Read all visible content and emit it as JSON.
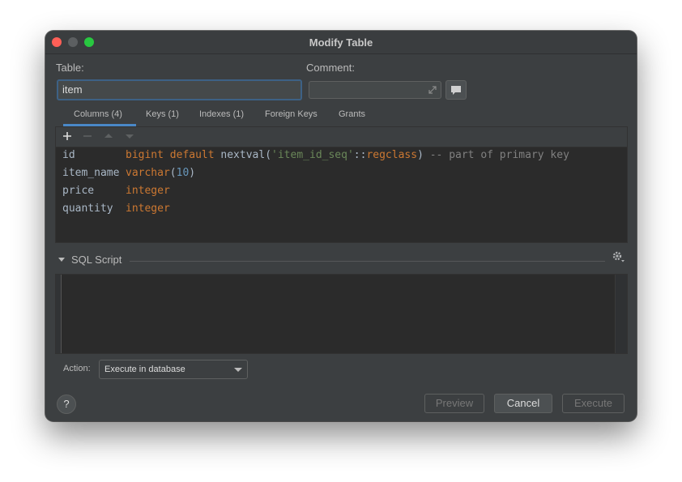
{
  "window": {
    "title": "Modify Table"
  },
  "form": {
    "table_label": "Table:",
    "table_value": "item",
    "comment_label": "Comment:",
    "comment_value": ""
  },
  "tabs": [
    {
      "label": "Columns (4)",
      "active": true
    },
    {
      "label": "Keys (1)",
      "active": false
    },
    {
      "label": "Indexes (1)",
      "active": false
    },
    {
      "label": "Foreign Keys",
      "active": false
    },
    {
      "label": "Grants",
      "active": false
    }
  ],
  "columns": [
    {
      "name": "id",
      "def": {
        "kw1": "bigint default",
        "fn": "nextval(",
        "str": "'item_id_seq'",
        "op": "::",
        "kw2": "regclass",
        "close": ")",
        "comment": "-- part of primary key"
      }
    },
    {
      "name": "item_name",
      "def": {
        "type": "varchar",
        "open": "(",
        "num": "10",
        "close": ")"
      }
    },
    {
      "name": "price",
      "def": {
        "type": "integer"
      }
    },
    {
      "name": "quantity",
      "def": {
        "type": "integer"
      }
    }
  ],
  "toolbar": {
    "add_icon": "plus-icon",
    "remove_icon": "minus-icon",
    "up_icon": "arrow-up-icon",
    "down_icon": "arrow-down-icon"
  },
  "sql": {
    "label": "SQL Script",
    "script": ""
  },
  "action": {
    "label": "Action:",
    "selected": "Execute in database"
  },
  "buttons": {
    "help": "?",
    "preview": "Preview",
    "cancel": "Cancel",
    "execute": "Execute"
  },
  "colors": {
    "background": "#3c3f41",
    "editor": "#2b2b2b",
    "accent": "#4a88c7",
    "keyword": "#cc7832",
    "string": "#6a8759",
    "number": "#6897bb",
    "comment": "#808080"
  }
}
